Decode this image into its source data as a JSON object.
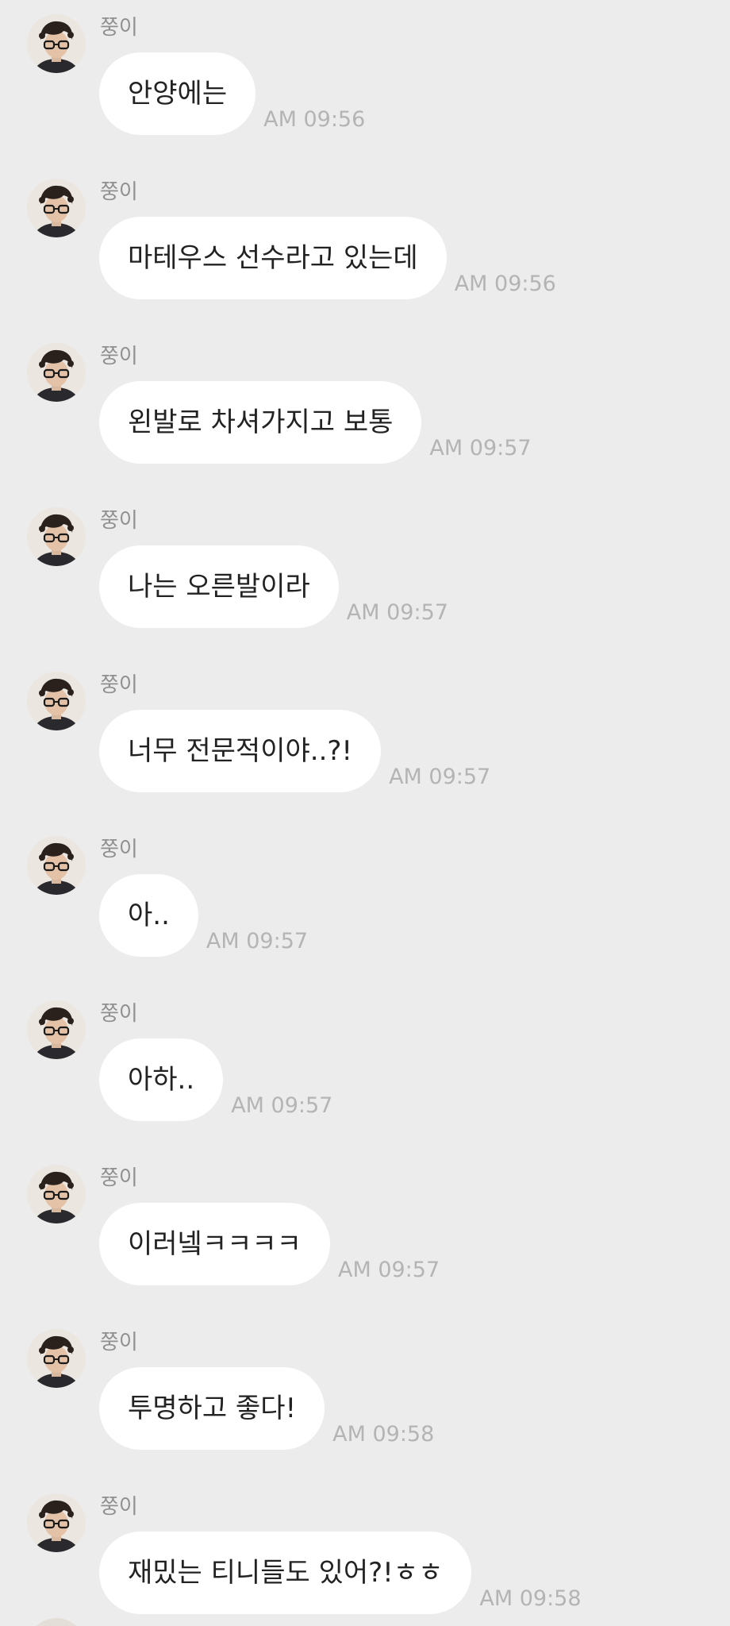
{
  "messages": [
    {
      "sender": "쭝이",
      "text": "안양에는",
      "time": "AM 09:56"
    },
    {
      "sender": "쭝이",
      "text": "마테우스 선수라고 있는데",
      "time": "AM 09:56"
    },
    {
      "sender": "쭝이",
      "text": "왼발로 차셔가지고 보통",
      "time": "AM 09:57"
    },
    {
      "sender": "쭝이",
      "text": "나는 오른발이라",
      "time": "AM 09:57"
    },
    {
      "sender": "쭝이",
      "text": "너무 전문적이야..?!",
      "time": "AM 09:57"
    },
    {
      "sender": "쭝이",
      "text": "아..",
      "time": "AM 09:57"
    },
    {
      "sender": "쭝이",
      "text": "아하..",
      "time": "AM 09:57"
    },
    {
      "sender": "쭝이",
      "text": "이러넼ㅋㅋㅋㅋ",
      "time": "AM 09:57"
    },
    {
      "sender": "쭝이",
      "text": "투명하고 좋다!",
      "time": "AM 09:58"
    },
    {
      "sender": "쭝이",
      "text": "재밌는 티니들도 있어?!ㅎㅎ",
      "time": "AM 09:58"
    }
  ],
  "colors": {
    "background": "#ececec",
    "bubble": "#ffffff",
    "sender_text": "#8f8f8f",
    "time_text": "#b4b4b4",
    "message_text": "#222222"
  },
  "icons": {
    "avatar": "profile-photo-avatar"
  }
}
